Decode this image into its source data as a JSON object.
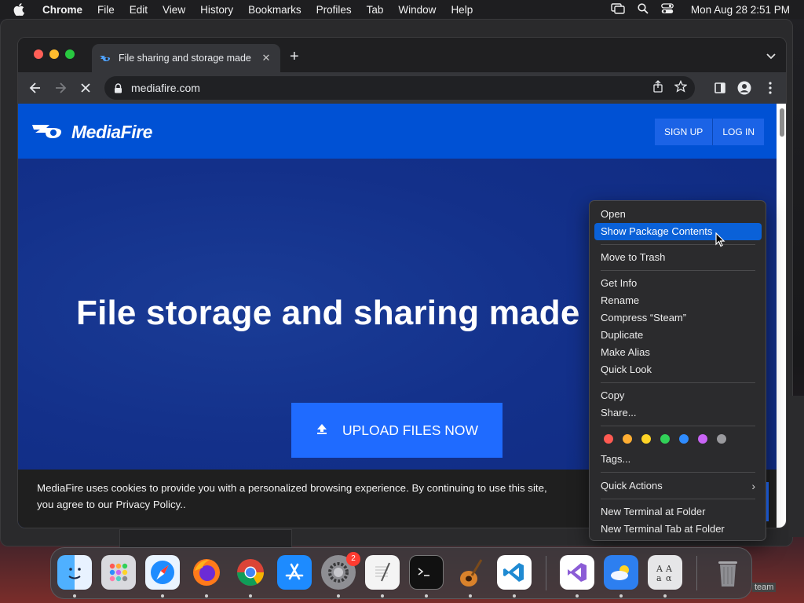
{
  "menubar": {
    "app_name": "Chrome",
    "items": [
      "File",
      "Edit",
      "View",
      "History",
      "Bookmarks",
      "Profiles",
      "Tab",
      "Window",
      "Help"
    ],
    "clock": "Mon Aug 28  2:51 PM"
  },
  "browser": {
    "tab_title": "File sharing and storage made",
    "url": "mediafire.com"
  },
  "page": {
    "logo_text": "MediaFire",
    "signup_label": "SIGN UP",
    "login_label": "LOG IN",
    "hero_title": "File storage and sharing made",
    "upload_label": "UPLOAD FILES NOW",
    "cookie_line1": "MediaFire uses cookies to provide you with a personalized browsing experience. By continuing to use this site,",
    "cookie_line2": "you agree to our Privacy Policy.."
  },
  "context_menu": {
    "open": "Open",
    "show_package_contents": "Show Package Contents",
    "move_to_trash": "Move to Trash",
    "get_info": "Get Info",
    "rename": "Rename",
    "compress": "Compress “Steam”",
    "duplicate": "Duplicate",
    "make_alias": "Make Alias",
    "quick_look": "Quick Look",
    "copy": "Copy",
    "share": "Share...",
    "tags": "Tags...",
    "quick_actions": "Quick Actions",
    "new_terminal": "New Terminal at Folder",
    "new_terminal_tab": "New Terminal Tab at Folder",
    "tag_colors": [
      "#ff5a52",
      "#ffae33",
      "#ffd426",
      "#31d158",
      "#2f8cff",
      "#c964f5",
      "#9a9a9e"
    ]
  },
  "dock": {
    "settings_badge": "2",
    "steam_label": "team"
  },
  "colors": {
    "brand_blue": "#0051d4",
    "upload_blue": "#1f6bff",
    "menu_highlight": "#0a61d8"
  }
}
